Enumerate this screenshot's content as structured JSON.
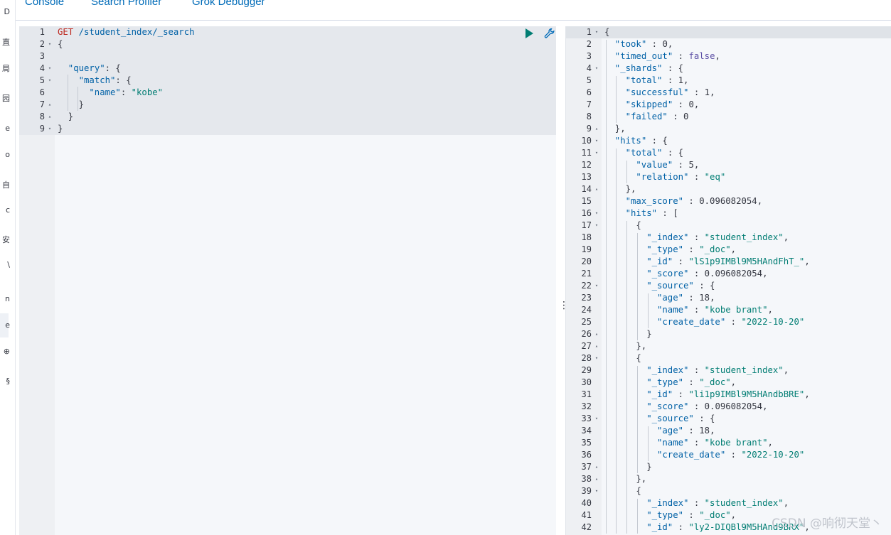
{
  "tabs": [
    "Console",
    "Search Profiler",
    "Grok Debugger"
  ],
  "left_rail_glyphs": [
    "D",
    "直",
    "局",
    "园",
    "e",
    "o",
    "自",
    "c",
    "安",
    "\\",
    "n",
    "e",
    "⊕",
    "§"
  ],
  "request": {
    "method": "GET",
    "path": " /student_index/_search",
    "lines": [
      {
        "n": "1",
        "fold": "",
        "html": "REQ"
      },
      {
        "n": "2",
        "fold": "▾",
        "text": "{"
      },
      {
        "n": "3",
        "fold": "",
        "text": ""
      },
      {
        "n": "4",
        "fold": "▾",
        "key": "\"query\"",
        "rest": ": {",
        "indent": 2
      },
      {
        "n": "5",
        "fold": "▾",
        "key": "\"match\"",
        "rest": ": {",
        "indent": 4
      },
      {
        "n": "6",
        "fold": "",
        "key": "\"name\"",
        "rest": ": ",
        "str": "\"kobe\"",
        "indent": 6
      },
      {
        "n": "7",
        "fold": "▴",
        "text": "}",
        "indent": 4
      },
      {
        "n": "8",
        "fold": "▴",
        "text": "}",
        "indent": 2
      },
      {
        "n": "9",
        "fold": "▾",
        "text": "}",
        "indent": 0
      }
    ]
  },
  "actions": {
    "run_label": "Send request",
    "settings_label": "Request options"
  },
  "response": {
    "lines": [
      {
        "n": "1",
        "f": "▾",
        "i": 0,
        "t": "{"
      },
      {
        "n": "2",
        "f": "",
        "i": 2,
        "k": "\"took\"",
        "v": "0",
        "c": ","
      },
      {
        "n": "3",
        "f": "",
        "i": 2,
        "k": "\"timed_out\"",
        "v": "false",
        "c": ",",
        "vt": "b"
      },
      {
        "n": "4",
        "f": "▾",
        "i": 2,
        "k": "\"_shards\"",
        "r": " : {"
      },
      {
        "n": "5",
        "f": "",
        "i": 4,
        "k": "\"total\"",
        "v": "1",
        "c": ","
      },
      {
        "n": "6",
        "f": "",
        "i": 4,
        "k": "\"successful\"",
        "v": "1",
        "c": ","
      },
      {
        "n": "7",
        "f": "",
        "i": 4,
        "k": "\"skipped\"",
        "v": "0",
        "c": ","
      },
      {
        "n": "8",
        "f": "",
        "i": 4,
        "k": "\"failed\"",
        "v": "0",
        "c": ""
      },
      {
        "n": "9",
        "f": "▴",
        "i": 2,
        "t": "},"
      },
      {
        "n": "10",
        "f": "▾",
        "i": 2,
        "k": "\"hits\"",
        "r": " : {"
      },
      {
        "n": "11",
        "f": "▾",
        "i": 4,
        "k": "\"total\"",
        "r": " : {"
      },
      {
        "n": "12",
        "f": "",
        "i": 6,
        "k": "\"value\"",
        "v": "5",
        "c": ","
      },
      {
        "n": "13",
        "f": "",
        "i": 6,
        "k": "\"relation\"",
        "s": "\"eq\"",
        "c": ""
      },
      {
        "n": "14",
        "f": "▴",
        "i": 4,
        "t": "},"
      },
      {
        "n": "15",
        "f": "",
        "i": 4,
        "k": "\"max_score\"",
        "v": "0.096082054",
        "c": ","
      },
      {
        "n": "16",
        "f": "▾",
        "i": 4,
        "k": "\"hits\"",
        "r": " : ["
      },
      {
        "n": "17",
        "f": "▾",
        "i": 6,
        "t": "{"
      },
      {
        "n": "18",
        "f": "",
        "i": 8,
        "k": "\"_index\"",
        "s": "\"student_index\"",
        "c": ","
      },
      {
        "n": "19",
        "f": "",
        "i": 8,
        "k": "\"_type\"",
        "s": "\"_doc\"",
        "c": ","
      },
      {
        "n": "20",
        "f": "",
        "i": 8,
        "k": "\"_id\"",
        "s": "\"lS1p9IMBl9M5HAndFhT_\"",
        "c": ","
      },
      {
        "n": "21",
        "f": "",
        "i": 8,
        "k": "\"_score\"",
        "v": "0.096082054",
        "c": ","
      },
      {
        "n": "22",
        "f": "▾",
        "i": 8,
        "k": "\"_source\"",
        "r": " : {"
      },
      {
        "n": "23",
        "f": "",
        "i": 10,
        "k": "\"age\"",
        "v": "18",
        "c": ","
      },
      {
        "n": "24",
        "f": "",
        "i": 10,
        "k": "\"name\"",
        "s": "\"kobe brant\"",
        "c": ","
      },
      {
        "n": "25",
        "f": "",
        "i": 10,
        "k": "\"create_date\"",
        "s": "\"2022-10-20\"",
        "c": ""
      },
      {
        "n": "26",
        "f": "▴",
        "i": 8,
        "t": "}"
      },
      {
        "n": "27",
        "f": "▴",
        "i": 6,
        "t": "},"
      },
      {
        "n": "28",
        "f": "▾",
        "i": 6,
        "t": "{"
      },
      {
        "n": "29",
        "f": "",
        "i": 8,
        "k": "\"_index\"",
        "s": "\"student_index\"",
        "c": ","
      },
      {
        "n": "30",
        "f": "",
        "i": 8,
        "k": "\"_type\"",
        "s": "\"_doc\"",
        "c": ","
      },
      {
        "n": "31",
        "f": "",
        "i": 8,
        "k": "\"_id\"",
        "s": "\"li1p9IMBl9M5HAndbBRE\"",
        "c": ","
      },
      {
        "n": "32",
        "f": "",
        "i": 8,
        "k": "\"_score\"",
        "v": "0.096082054",
        "c": ","
      },
      {
        "n": "33",
        "f": "▾",
        "i": 8,
        "k": "\"_source\"",
        "r": " : {"
      },
      {
        "n": "34",
        "f": "",
        "i": 10,
        "k": "\"age\"",
        "v": "18",
        "c": ","
      },
      {
        "n": "35",
        "f": "",
        "i": 10,
        "k": "\"name\"",
        "s": "\"kobe brant\"",
        "c": ","
      },
      {
        "n": "36",
        "f": "",
        "i": 10,
        "k": "\"create_date\"",
        "s": "\"2022-10-20\"",
        "c": ""
      },
      {
        "n": "37",
        "f": "▴",
        "i": 8,
        "t": "}"
      },
      {
        "n": "38",
        "f": "▴",
        "i": 6,
        "t": "},"
      },
      {
        "n": "39",
        "f": "▾",
        "i": 6,
        "t": "{"
      },
      {
        "n": "40",
        "f": "",
        "i": 8,
        "k": "\"_index\"",
        "s": "\"student_index\"",
        "c": ","
      },
      {
        "n": "41",
        "f": "",
        "i": 8,
        "k": "\"_type\"",
        "s": "\"_doc\"",
        "c": ","
      },
      {
        "n": "42",
        "f": "",
        "i": 8,
        "k": "\"_id\"",
        "s": "\"ly2-DIQBl9M5HAnd9BRX\"",
        "c": ","
      }
    ]
  },
  "watermark": "CSDN @响彻天堂丶",
  "colors": {
    "accent": "#006bb8",
    "string": "#017d73",
    "method": "#bd271e"
  }
}
